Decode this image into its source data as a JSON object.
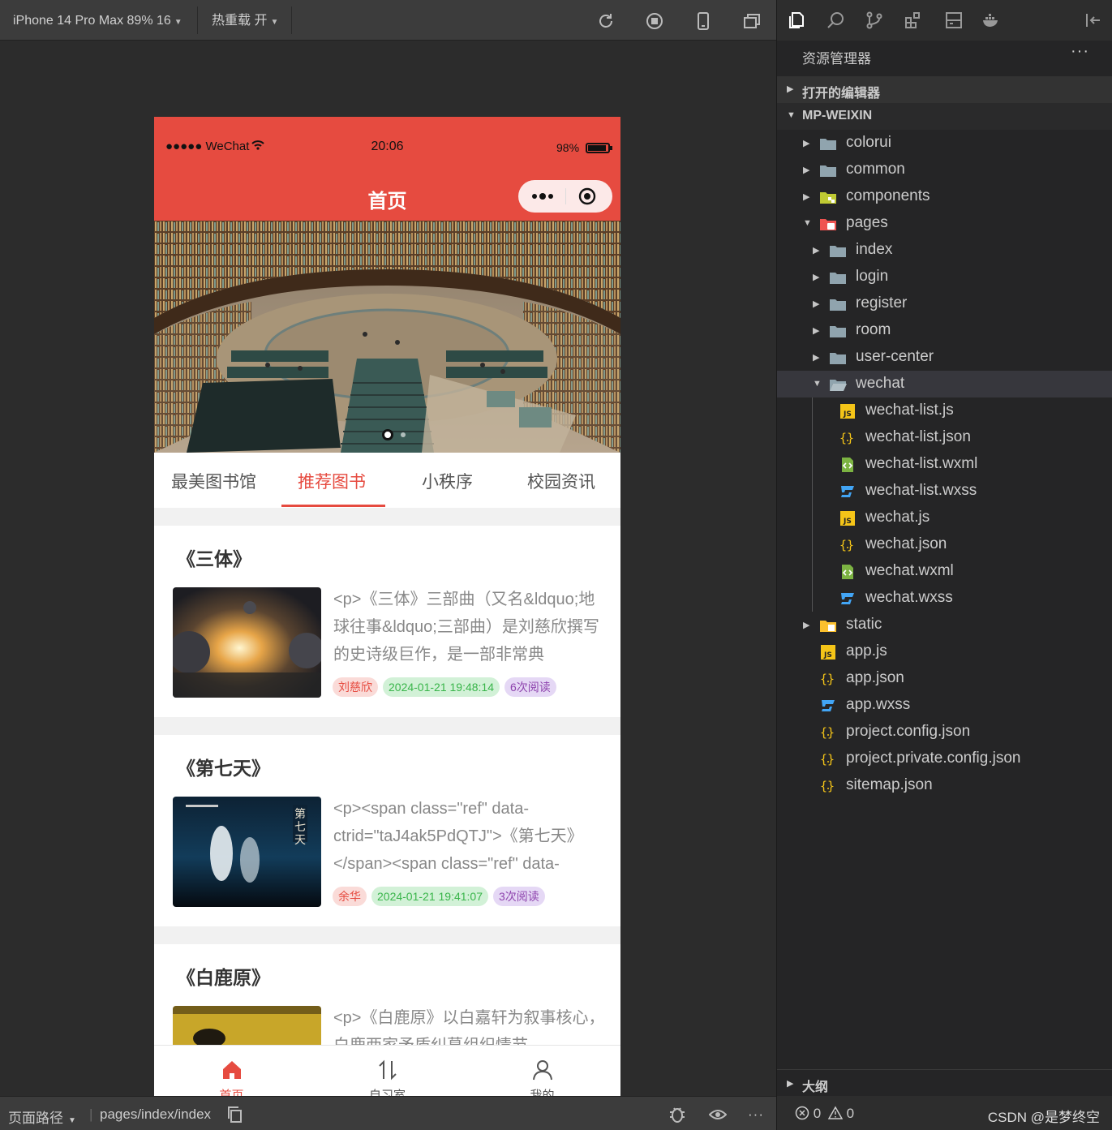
{
  "simulator": {
    "device_label": "iPhone 14 Pro Max 89% 16",
    "hot_reload_label": "热重载 开"
  },
  "phone": {
    "status": {
      "carrier": "●●●●● WeChat",
      "time": "20:06",
      "battery": "98%"
    },
    "nav_title": "首页",
    "banner_pages": 2,
    "banner_active_index": 0,
    "tabs": [
      "最美图书馆",
      "推荐图书",
      "小秩序",
      "校园资讯"
    ],
    "active_tab": 1,
    "books": [
      {
        "title": "《三体》",
        "desc": "<p>《三体》三部曲（又名&ldquo;地球往事&ldquo;三部曲）是刘慈欣撰写的史诗级巨作，是一部非常典",
        "author": "刘慈欣",
        "date": "2024-01-21 19:48:14",
        "reads": "6次阅读"
      },
      {
        "title": "《第七天》",
        "desc": "<p><span class=\"ref\" data-ctrid=\"taJ4ak5PdQTJ\">《第七天》</span><span class=\"ref\" data-",
        "author": "余华",
        "date": "2024-01-21 19:41:07",
        "reads": "3次阅读"
      },
      {
        "title": "《白鹿原》",
        "desc": "<p>《白鹿原》以白嘉轩为叙事核心，白鹿两家矛盾纠葛组织情节",
        "author": "",
        "date": "",
        "reads": ""
      }
    ],
    "tabbar": [
      {
        "label": "首页",
        "icon": "home-icon",
        "active": true
      },
      {
        "label": "自习室",
        "icon": "sort-arrows-icon",
        "active": false
      },
      {
        "label": "我的",
        "icon": "user-icon",
        "active": false
      }
    ]
  },
  "bottom_bar": {
    "page_path_label": "页面路径",
    "page_path": "pages/index/index"
  },
  "explorer": {
    "title": "资源管理器",
    "more": "···",
    "open_editors": "打开的编辑器",
    "project": "MP-WEIXIN",
    "tree": [
      {
        "label": "colorui",
        "type": "folder",
        "depth": 1,
        "expanded": false
      },
      {
        "label": "common",
        "type": "folder",
        "depth": 1,
        "expanded": false
      },
      {
        "label": "components",
        "type": "folder-components",
        "depth": 1,
        "expanded": false
      },
      {
        "label": "pages",
        "type": "folder-pages",
        "depth": 1,
        "expanded": true
      },
      {
        "label": "index",
        "type": "folder",
        "depth": 2,
        "expanded": false
      },
      {
        "label": "login",
        "type": "folder",
        "depth": 2,
        "expanded": false
      },
      {
        "label": "register",
        "type": "folder",
        "depth": 2,
        "expanded": false
      },
      {
        "label": "room",
        "type": "folder",
        "depth": 2,
        "expanded": false
      },
      {
        "label": "user-center",
        "type": "folder",
        "depth": 2,
        "expanded": false
      },
      {
        "label": "wechat",
        "type": "folder-open",
        "depth": 2,
        "expanded": true,
        "selected": true
      },
      {
        "label": "wechat-list.js",
        "type": "js",
        "depth": 3
      },
      {
        "label": "wechat-list.json",
        "type": "json",
        "depth": 3
      },
      {
        "label": "wechat-list.wxml",
        "type": "wxml",
        "depth": 3
      },
      {
        "label": "wechat-list.wxss",
        "type": "wxss",
        "depth": 3
      },
      {
        "label": "wechat.js",
        "type": "js",
        "depth": 3
      },
      {
        "label": "wechat.json",
        "type": "json",
        "depth": 3
      },
      {
        "label": "wechat.wxml",
        "type": "wxml",
        "depth": 3
      },
      {
        "label": "wechat.wxss",
        "type": "wxss",
        "depth": 3
      },
      {
        "label": "static",
        "type": "folder-static",
        "depth": 1,
        "expanded": false
      },
      {
        "label": "app.js",
        "type": "js",
        "depth": 1
      },
      {
        "label": "app.json",
        "type": "json",
        "depth": 1
      },
      {
        "label": "app.wxss",
        "type": "wxss",
        "depth": 1
      },
      {
        "label": "project.config.json",
        "type": "json",
        "depth": 1
      },
      {
        "label": "project.private.config.json",
        "type": "json",
        "depth": 1
      },
      {
        "label": "sitemap.json",
        "type": "json",
        "depth": 1
      }
    ],
    "outline": "大纲",
    "problems": {
      "errors": "0",
      "warnings": "0"
    },
    "credit": "CSDN @是梦终空"
  },
  "colors": {
    "accent": "#e64b40",
    "tag_green": "#39b54a",
    "tag_purple": "#8e44ad"
  }
}
